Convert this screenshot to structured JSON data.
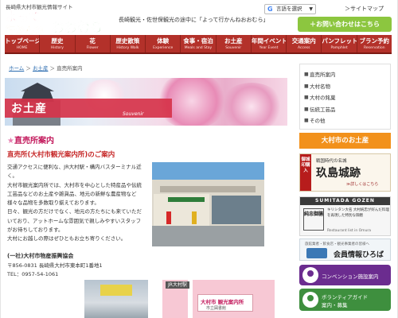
{
  "header": {
    "tagline": "長崎県大村市観光情報サイト",
    "logo_text": "よって行かんね おおむら",
    "description": "長崎観光・佐世保観光の途中に「よって行かんねおおむら」",
    "lang_select": "言語を選択",
    "sitemap": "＞サイトマップ",
    "contact_button": "＋お問い合わせはこちら"
  },
  "nav": [
    {
      "jp": "トップページ",
      "en": "HOME"
    },
    {
      "jp": "歴史",
      "en": "History"
    },
    {
      "jp": "花",
      "en": "Flower"
    },
    {
      "jp": "歴史散策",
      "en": "History Walk"
    },
    {
      "jp": "体験",
      "en": "Experience"
    },
    {
      "jp": "食事・宿泊",
      "en": "Meals and Stay"
    },
    {
      "jp": "お土産",
      "en": "Souvenir"
    },
    {
      "jp": "年間イベント",
      "en": "Year Event"
    },
    {
      "jp": "交通案内",
      "en": "Access"
    },
    {
      "jp": "パンフレット",
      "en": "Pamphlet"
    },
    {
      "jp": "ブラン予約",
      "en": "Reservation"
    }
  ],
  "breadcrumb": {
    "home": "ホーム",
    "sep1": "＞",
    "parent": "お土産",
    "sep2": "＞",
    "current": "直売所案内"
  },
  "hero": {
    "title": "お土産",
    "subtitle": "Souvenir"
  },
  "main": {
    "heading_star": "★",
    "heading": "直売所案内",
    "shop_title": "直売所(大村市観光案内所)のご案内",
    "desc_lines": [
      "交通アクセスに便利な、JR大村駅・構内バスターミナル近く。",
      "大村市観光案内所では、大村市を中心とした特産品や伝統",
      "工芸品などのお土産や雑貨品、地元の新鮮な農産物など",
      "様々な品物を多数取り揃えております。",
      "日々、観光の方だけでなく、地元の方たちにも来ていただ",
      "いており、アットホームな雰囲気で親しみやすいスタッフ",
      "がお待ちしております。",
      "大村にお越しの際はぜひともお立ち寄りください。"
    ],
    "org_name": "(一社)大村市物産振興協会",
    "org_address": "〒856-0831 長崎県大村市東本町1番地1",
    "org_tel": "TEL：0957-54-1061",
    "map_station": "JR大村駅",
    "map_label": "大村市 観光案内所",
    "map_sub": "市立図書館"
  },
  "sidebar": {
    "menu": [
      "直売所案内",
      "大村名物",
      "大村の銘菓",
      "伝統工芸品",
      "その他"
    ],
    "heading": "大村市のお土産",
    "goshuin": {
      "vert": "御城印購入",
      "line1": "戦国時代の名城",
      "line2": "玖島城跡",
      "line3": "≫詳しくはこちら"
    },
    "sumitada": {
      "bar": "SUMITADA GOZEN",
      "ks": "純忠御膳",
      "desc": "キリシタン大名 大村純忠が好んだ料理を再現した特別な御膳",
      "rest": "Restaurant list in Omura"
    },
    "member": {
      "line1": "旅館業者・飲食店・観光事業者の皆様へ",
      "line2": "会員情報ひろば"
    },
    "convention": "コンベンション施設案内",
    "volunteer_line1": "ボランティアガイド",
    "volunteer_line2": "案内・募集"
  }
}
